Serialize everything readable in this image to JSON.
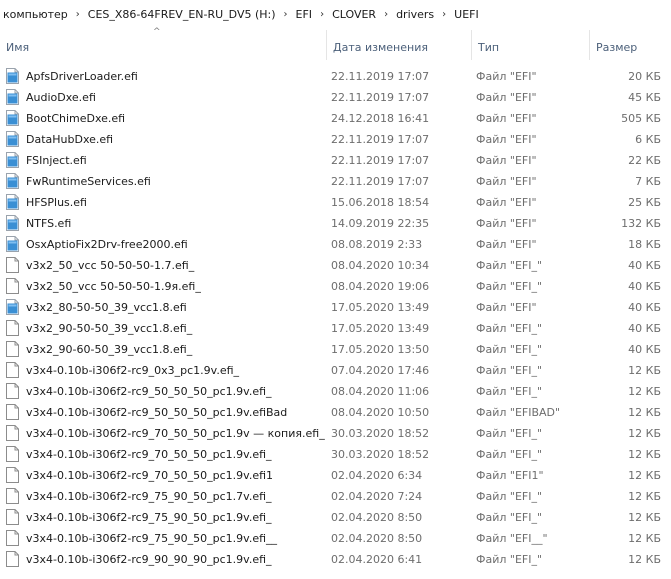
{
  "breadcrumb": {
    "items": [
      "компьютер",
      "CES_X86-64FREV_EN-RU_DV5 (H:)",
      "EFI",
      "CLOVER",
      "drivers",
      "UEFI"
    ],
    "separator": "›"
  },
  "columns": {
    "name": "Имя",
    "date": "Дата изменения",
    "type": "Тип",
    "size": "Размер"
  },
  "colors": {
    "efi_icon_blue": "#3a8fd4",
    "header_text": "#4c607a",
    "meta_text": "#6d6d6d"
  },
  "files": [
    {
      "name": "ApfsDriverLoader.efi",
      "date": "22.11.2019 17:07",
      "type": "Файл \"EFI\"",
      "size": "20 КБ",
      "icon": "efi-file-icon"
    },
    {
      "name": "AudioDxe.efi",
      "date": "22.11.2019 17:07",
      "type": "Файл \"EFI\"",
      "size": "45 КБ",
      "icon": "efi-file-icon"
    },
    {
      "name": "BootChimeDxe.efi",
      "date": "24.12.2018 16:41",
      "type": "Файл \"EFI\"",
      "size": "505 КБ",
      "icon": "efi-file-icon"
    },
    {
      "name": "DataHubDxe.efi",
      "date": "22.11.2019 17:07",
      "type": "Файл \"EFI\"",
      "size": "6 КБ",
      "icon": "efi-file-icon"
    },
    {
      "name": "FSInject.efi",
      "date": "22.11.2019 17:07",
      "type": "Файл \"EFI\"",
      "size": "22 КБ",
      "icon": "efi-file-icon"
    },
    {
      "name": "FwRuntimeServices.efi",
      "date": "22.11.2019 17:07",
      "type": "Файл \"EFI\"",
      "size": "7 КБ",
      "icon": "efi-file-icon"
    },
    {
      "name": "HFSPlus.efi",
      "date": "15.06.2018 18:54",
      "type": "Файл \"EFI\"",
      "size": "25 КБ",
      "icon": "efi-file-icon"
    },
    {
      "name": "NTFS.efi",
      "date": "14.09.2019 22:35",
      "type": "Файл \"EFI\"",
      "size": "132 КБ",
      "icon": "efi-file-icon"
    },
    {
      "name": "OsxAptioFix2Drv-free2000.efi",
      "date": "08.08.2019 2:33",
      "type": "Файл \"EFI\"",
      "size": "18 КБ",
      "icon": "efi-file-icon"
    },
    {
      "name": "v3x2_50_vcc  50-50-50-1.7.efi_",
      "date": "08.04.2020 10:34",
      "type": "Файл \"EFI_\"",
      "size": "40 КБ",
      "icon": "blank-file-icon"
    },
    {
      "name": "v3x2_50_vcc  50-50-50-1.9я.efi_",
      "date": "08.04.2020 19:06",
      "type": "Файл \"EFI_\"",
      "size": "40 КБ",
      "icon": "blank-file-icon"
    },
    {
      "name": "v3x2_80-50-50_39_vcc1.8.efi",
      "date": "17.05.2020 13:49",
      "type": "Файл \"EFI\"",
      "size": "40 КБ",
      "icon": "efi-file-icon"
    },
    {
      "name": "v3x2_90-50-50_39_vcc1.8.efi_",
      "date": "17.05.2020 13:49",
      "type": "Файл \"EFI_\"",
      "size": "40 КБ",
      "icon": "blank-file-icon"
    },
    {
      "name": "v3x2_90-60-50_39_vcc1.8.efi_",
      "date": "17.05.2020 13:50",
      "type": "Файл \"EFI_\"",
      "size": "40 КБ",
      "icon": "blank-file-icon"
    },
    {
      "name": "v3x4-0.10b-i306f2-rc9_0x3_pc1.9v.efi_",
      "date": "07.04.2020 17:46",
      "type": "Файл \"EFI_\"",
      "size": "12 КБ",
      "icon": "blank-file-icon"
    },
    {
      "name": "v3x4-0.10b-i306f2-rc9_50_50_50_pc1.9v.efi_",
      "date": "08.04.2020 11:06",
      "type": "Файл \"EFI_\"",
      "size": "12 КБ",
      "icon": "blank-file-icon"
    },
    {
      "name": "v3x4-0.10b-i306f2-rc9_50_50_50_pc1.9v.efiBad",
      "date": "08.04.2020 10:50",
      "type": "Файл \"EFIBAD\"",
      "size": "12 КБ",
      "icon": "blank-file-icon"
    },
    {
      "name": "v3x4-0.10b-i306f2-rc9_70_50_50_pc1.9v — копия.efi_",
      "date": "30.03.2020 18:52",
      "type": "Файл \"EFI_\"",
      "size": "12 КБ",
      "icon": "blank-file-icon"
    },
    {
      "name": "v3x4-0.10b-i306f2-rc9_70_50_50_pc1.9v.efi_",
      "date": "30.03.2020 18:52",
      "type": "Файл \"EFI_\"",
      "size": "12 КБ",
      "icon": "blank-file-icon"
    },
    {
      "name": "v3x4-0.10b-i306f2-rc9_70_50_50_pc1.9v.efi1",
      "date": "02.04.2020 6:34",
      "type": "Файл \"EFI1\"",
      "size": "12 КБ",
      "icon": "blank-file-icon"
    },
    {
      "name": "v3x4-0.10b-i306f2-rc9_75_90_50_pc1.7v.efi_",
      "date": "02.04.2020 7:24",
      "type": "Файл \"EFI_\"",
      "size": "12 КБ",
      "icon": "blank-file-icon"
    },
    {
      "name": "v3x4-0.10b-i306f2-rc9_75_90_50_pc1.9v.efi_",
      "date": "02.04.2020 8:50",
      "type": "Файл \"EFI_\"",
      "size": "12 КБ",
      "icon": "blank-file-icon"
    },
    {
      "name": "v3x4-0.10b-i306f2-rc9_75_90_50_pc1.9v.efi__",
      "date": "02.04.2020 8:50",
      "type": "Файл \"EFI__\"",
      "size": "12 КБ",
      "icon": "blank-file-icon"
    },
    {
      "name": "v3x4-0.10b-i306f2-rc9_90_90_90_pc1.9v.efi_",
      "date": "02.04.2020 6:41",
      "type": "Файл \"EFI_\"",
      "size": "12 КБ",
      "icon": "blank-file-icon"
    }
  ]
}
